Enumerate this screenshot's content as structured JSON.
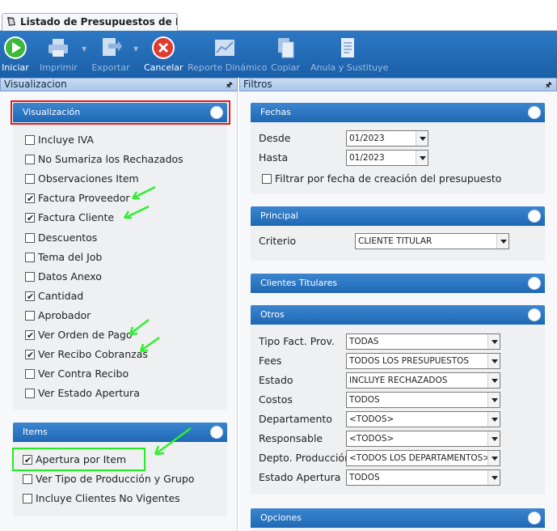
{
  "tab": {
    "title": "Listado de Presupuestos de Prod..."
  },
  "toolbar": {
    "iniciar": "Iniciar",
    "imprimir": "Imprimir",
    "exportar": "Exportar",
    "cancelar": "Cancelar",
    "reporte": "Reporte Dinámico",
    "copiar": "Copiar",
    "anula": "Anula y Sustituye"
  },
  "left_panel": {
    "title": "Visualizacion",
    "visualizacion_group": {
      "title": "Visualización",
      "items": [
        {
          "label": "Incluye IVA",
          "checked": false
        },
        {
          "label": "No Sumariza los Rechazados",
          "checked": false
        },
        {
          "label": "Observaciones Item",
          "checked": false
        },
        {
          "label": "Factura Proveedor",
          "checked": true
        },
        {
          "label": "Factura Cliente",
          "checked": true
        },
        {
          "label": "Descuentos",
          "checked": false
        },
        {
          "label": "Tema del Job",
          "checked": false
        },
        {
          "label": "Datos Anexo",
          "checked": false
        },
        {
          "label": "Cantidad",
          "checked": true
        },
        {
          "label": "Aprobador",
          "checked": false
        },
        {
          "label": "Ver Orden de Pago",
          "checked": true
        },
        {
          "label": "Ver Recibo Cobranzas",
          "checked": true
        },
        {
          "label": "Ver Contra Recibo",
          "checked": false
        },
        {
          "label": "Ver Estado Apertura",
          "checked": false
        }
      ]
    },
    "items_group": {
      "title": "Items",
      "items": [
        {
          "label": "Apertura por Item",
          "checked": true
        },
        {
          "label": "Ver Tipo de Producción y Grupo",
          "checked": false
        },
        {
          "label": "Incluye Clientes No Vigentes",
          "checked": false
        }
      ]
    }
  },
  "right_panel": {
    "title": "Filtros",
    "fechas": {
      "title": "Fechas",
      "desde_label": "Desde",
      "desde_value": "01/2023",
      "hasta_label": "Hasta",
      "hasta_value": "01/2023",
      "filtrar_label": "Filtrar por fecha de creación del presupuesto",
      "filtrar_checked": false
    },
    "principal": {
      "title": "Principal",
      "criterio_label": "Criterio",
      "criterio_value": "CLIENTE TITULAR"
    },
    "clientes": {
      "title": "Clientes Titulares"
    },
    "otros": {
      "title": "Otros",
      "rows": [
        {
          "label": "Tipo Fact. Prov.",
          "value": "TODAS"
        },
        {
          "label": "Fees",
          "value": "TODOS LOS PRESUPUESTOS"
        },
        {
          "label": "Estado",
          "value": "INCLUYE RECHAZADOS"
        },
        {
          "label": "Costos",
          "value": "TODOS"
        },
        {
          "label": "Departamento",
          "value": "<TODOS>"
        },
        {
          "label": "Responsable",
          "value": "<TODOS>"
        },
        {
          "label": "Depto. Producción",
          "value": "<TODOS LOS DEPARTAMENTOS>"
        },
        {
          "label": "Estado Apertura",
          "value": "TODOS"
        }
      ]
    },
    "opciones": {
      "title": "Opciones"
    }
  },
  "colors": {
    "toolbar": "#1f68b4",
    "group_header": "#2a74c0",
    "highlight_red": "#e81818",
    "highlight_green": "#22ee22"
  }
}
